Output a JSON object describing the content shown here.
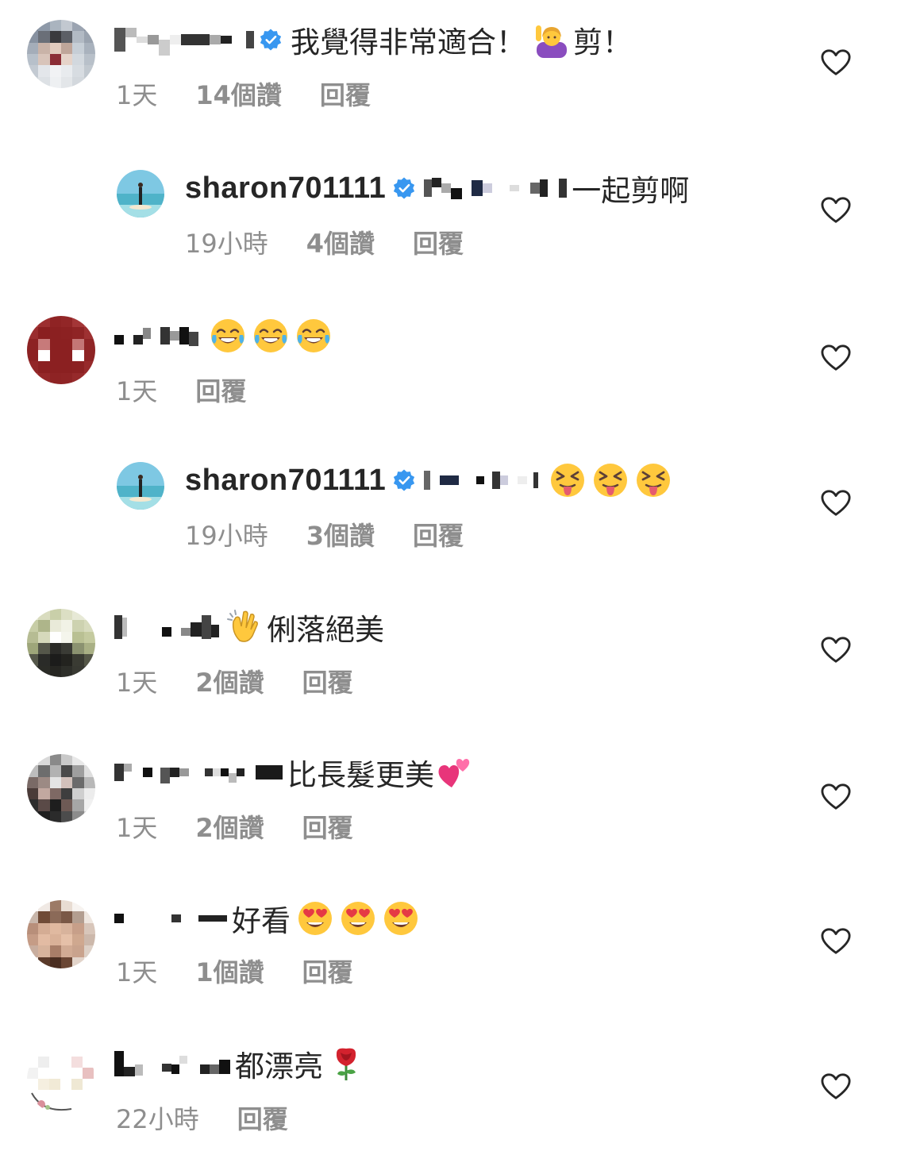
{
  "comments": [
    {
      "text": "我覺得非常適合！",
      "text2": "剪！",
      "time": "1天",
      "likes": "14個讚",
      "reply": "回覆",
      "verified": true
    },
    {
      "username": "sharon701111",
      "text": "一起剪啊",
      "time": "19小時",
      "likes": "4個讚",
      "reply": "回覆",
      "verified": true
    },
    {
      "time": "1天",
      "reply": "回覆"
    },
    {
      "username": "sharon701111",
      "time": "19小時",
      "likes": "3個讚",
      "reply": "回覆",
      "verified": true
    },
    {
      "text": "俐落絕美",
      "time": "1天",
      "likes": "2個讚",
      "reply": "回覆"
    },
    {
      "text": "比長髮更美",
      "time": "1天",
      "likes": "2個讚",
      "reply": "回覆"
    },
    {
      "text": "好看",
      "time": "1天",
      "likes": "1個讚",
      "reply": "回覆"
    },
    {
      "text": "都漂亮",
      "time": "22小時",
      "reply": "回覆"
    }
  ],
  "colors": {
    "text": "#262626",
    "meta": "#8e8e8e",
    "verified": "#3897f0"
  },
  "icons": {
    "like": "heart-outline-icon",
    "verified": "verified-badge-icon"
  }
}
